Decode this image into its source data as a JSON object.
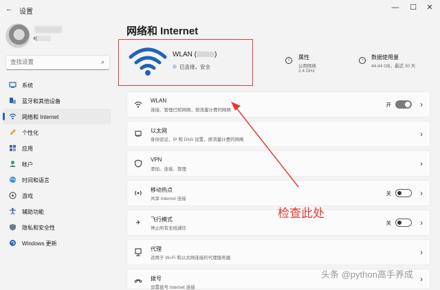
{
  "window": {
    "app_title": "设置",
    "back_icon": "back-arrow-icon",
    "minimize_icon": "minimize-icon",
    "maximize_icon": "maximize-icon",
    "close_icon": "close-icon"
  },
  "user": {
    "partial_text": "4("
  },
  "search": {
    "placeholder": "查找设置"
  },
  "nav": [
    {
      "label": "系统",
      "icon": "system-icon",
      "active": false
    },
    {
      "label": "蓝牙和其他设备",
      "icon": "bluetooth-icon",
      "active": false
    },
    {
      "label": "网络和 Internet",
      "icon": "network-icon",
      "active": true
    },
    {
      "label": "个性化",
      "icon": "brush-icon",
      "active": false
    },
    {
      "label": "应用",
      "icon": "apps-icon",
      "active": false
    },
    {
      "label": "帐户",
      "icon": "account-icon",
      "active": false
    },
    {
      "label": "时间和语言",
      "icon": "globe-icon",
      "active": false
    },
    {
      "label": "游戏",
      "icon": "gamepad-icon",
      "active": false
    },
    {
      "label": "辅助功能",
      "icon": "accessibility-icon",
      "active": false
    },
    {
      "label": "隐私和安全性",
      "icon": "shield-icon",
      "active": false
    },
    {
      "label": "Windows 更新",
      "icon": "update-icon",
      "active": false
    }
  ],
  "main": {
    "title": "网络和 Internet",
    "hero": {
      "name": "WLAN (",
      "name_end": ")",
      "status": "已连接，安全"
    },
    "properties": {
      "title": "属性",
      "sub1": "公用网络",
      "sub2": "2.4 GHz"
    },
    "usage": {
      "title": "数据使用量",
      "sub": "44.44 GB，最近 30 天"
    },
    "rows": [
      {
        "title": "WLAN",
        "sub": "连接、管理已知网络，按流量计费的网络",
        "icon": "wifi-icon",
        "toggle": "开",
        "toggle_on": true
      },
      {
        "title": "以太网",
        "sub": "身份验证，IP 和 DNS 设置，按流量计费的网络",
        "icon": "ethernet-icon",
        "toggle": "",
        "toggle_on": null
      },
      {
        "title": "VPN",
        "sub": "添加、连接、管理",
        "icon": "vpn-shield-icon",
        "toggle": "",
        "toggle_on": null
      },
      {
        "title": "移动热点",
        "sub": "共享 Internet 连接",
        "icon": "hotspot-icon",
        "toggle": "关",
        "toggle_on": false
      },
      {
        "title": "飞行模式",
        "sub": "停止所有无线通信",
        "icon": "airplane-icon",
        "toggle": "关",
        "toggle_on": false
      },
      {
        "title": "代理",
        "sub": "适用于 Wi-Fi 和以太网连接的代理服务器",
        "icon": "proxy-icon",
        "toggle": "",
        "toggle_on": null
      },
      {
        "title": "拨号",
        "sub": "设置拨号 Internet 连接",
        "icon": "dialup-icon",
        "toggle": "",
        "toggle_on": null
      }
    ]
  },
  "annotation": {
    "text": "检查此处",
    "color": "#e53935"
  },
  "watermark": "头条 @python高手养成",
  "colors": {
    "accent": "#1e63b8",
    "annotation_red": "#e53935",
    "background": "#f3f3f3"
  }
}
